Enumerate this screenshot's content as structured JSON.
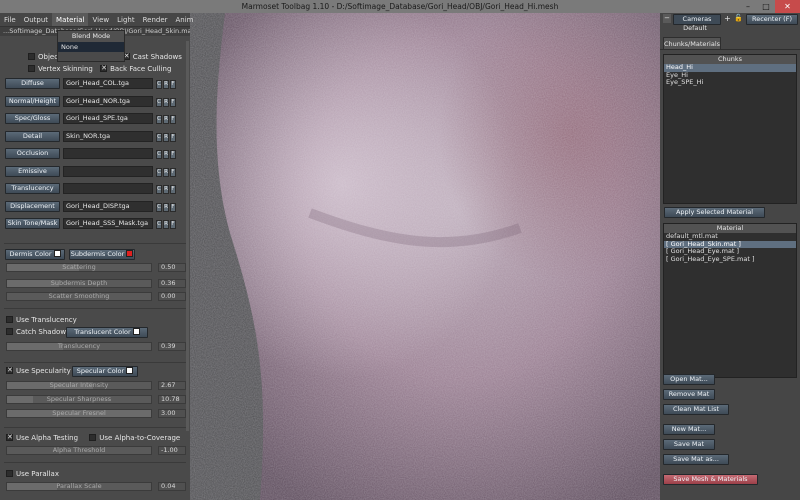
{
  "window": {
    "title": "Marmoset Toolbag 1.10 - D:/Softimage_Database/Gori_Head/OBJ/Gori_Head_Hi.mesh",
    "min": "–",
    "max": "□",
    "close": "✕"
  },
  "menu": [
    "File",
    "Output",
    "Material",
    "View",
    "Light",
    "Render",
    "Anim"
  ],
  "file_path": "...Softimage_Database/Gori_Head/OBJ/Gori_Head_Skin.mat",
  "blend_mode": {
    "label": "Blend Mode",
    "value": "None"
  },
  "options": {
    "object_space_normals": "Object Space Normals",
    "cast_shadows": "Cast Shadows",
    "vertex_skinning": "Vertex Skinning",
    "back_face_culling": "Back Face Culling"
  },
  "maps": [
    {
      "label": "Diffuse",
      "file": "Gori_Head_COL.tga"
    },
    {
      "label": "Normal/Height",
      "file": "Gori_Head_NOR.tga"
    },
    {
      "label": "Spec/Gloss",
      "file": "Gori_Head_SPE.tga"
    },
    {
      "label": "Detail",
      "file": "Skin_NOR.tga"
    },
    {
      "label": "Occlusion",
      "file": ""
    },
    {
      "label": "Emissive",
      "file": ""
    },
    {
      "label": "Translucency",
      "file": ""
    },
    {
      "label": "Displacement",
      "file": "Gori_Head_DISP.tga"
    },
    {
      "label": "Skin Tone/Mask",
      "file": "Gori_Head_SSS_Mask.tga"
    }
  ],
  "map_buttons": {
    "c": "C",
    "r": "R",
    "f": "F"
  },
  "skin": {
    "dermis_color": "Dermis Color",
    "subdermis_color": "Subdermis Color",
    "scattering": {
      "label": "Scattering",
      "value": "0.50",
      "level": 0.5
    },
    "subdermis_depth": {
      "label": "Subdermis Depth",
      "value": "0.36",
      "level": 0.36
    },
    "scatter_smoothing": {
      "label": "Scatter Smoothing",
      "value": "0.00",
      "level": 0.0
    }
  },
  "translucency": {
    "use": "Use Translucency",
    "catch_shadows": "Catch Shadows",
    "color": "Translucent Color",
    "slider": {
      "label": "Translucency",
      "value": "0.39",
      "level": 0.39
    }
  },
  "specular": {
    "use": "Use Specularity",
    "color": "Specular Color",
    "intensity": {
      "label": "Specular Intensity",
      "value": "2.67",
      "level": 0.6
    },
    "sharpness": {
      "label": "Specular Sharpness",
      "value": "10.78",
      "level": 0.18
    },
    "fresnel": {
      "label": "Specular Fresnel",
      "value": "3.00",
      "level": 1.0
    }
  },
  "alpha": {
    "use_testing": "Use Alpha Testing",
    "use_coverage": "Use Alpha-to-Coverage",
    "threshold": {
      "label": "Alpha Threshold",
      "value": "-1.00",
      "level": 0.0
    }
  },
  "parallax": {
    "use": "Use Parallax",
    "scale": {
      "label": "Parallax Scale",
      "value": "0.04",
      "level": 0.35
    }
  },
  "right": {
    "cameras": "Cameras",
    "camera_value": "Default",
    "recenter": "Recenter (F)",
    "tab": "Chunks/Materials",
    "chunks_header": "Chunks",
    "chunks": [
      "Head_Hi",
      "Eye_Hi",
      "Eye_SPE_Hi"
    ],
    "apply": "Apply Selected Material",
    "material_header": "Material",
    "materials": [
      "default_mtl.mat",
      "[ Gori_Head_Skin.mat ]",
      "[ Gori_Head_Eye.mat ]",
      "[ Gori_Head_Eye_SPE.mat ]"
    ],
    "open_mat": "Open Mat...",
    "remove_mat": "Remove Mat",
    "clean_list": "Clean Mat List",
    "new_mat": "New Mat...",
    "save_mat": "Save Mat",
    "save_mat_as": "Save Mat as...",
    "save_mesh": "Save Mesh & Materials"
  },
  "colors": {
    "dermis": "#ffffff",
    "subdermis": "#e02020",
    "translucent": "#ffffff",
    "specular": "#ffffff",
    "save_mesh": "#b9515a"
  }
}
